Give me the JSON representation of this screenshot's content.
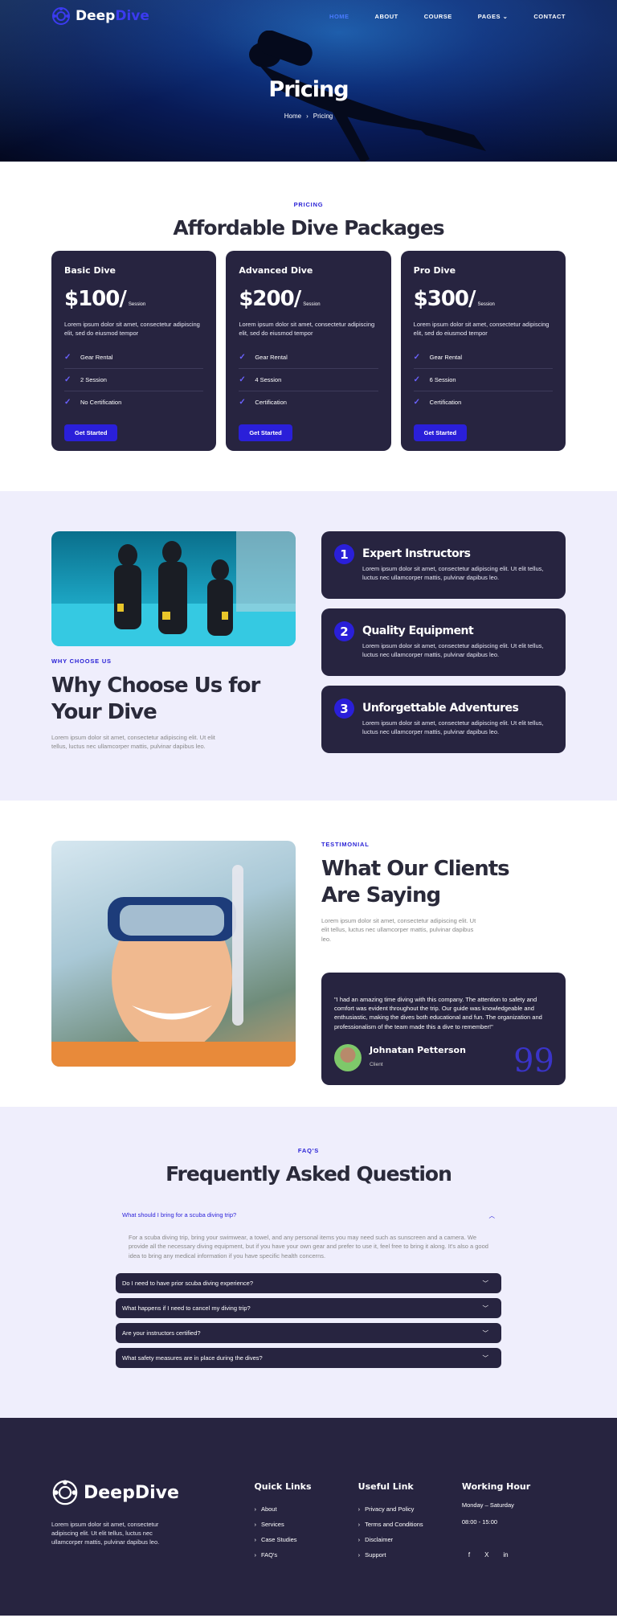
{
  "brand": {
    "name_part1": "Deep",
    "name_part2": "Dive"
  },
  "nav": {
    "items": [
      {
        "label": "HOME",
        "active": true
      },
      {
        "label": "ABOUT"
      },
      {
        "label": "COURSE"
      },
      {
        "label": "PAGES"
      },
      {
        "label": "CONTACT"
      }
    ]
  },
  "hero": {
    "title": "Pricing",
    "crumb_home": "Home",
    "crumb_current": "Pricing"
  },
  "pricing": {
    "eyebrow": "PRICING",
    "title": "Affordable Dive Packages",
    "cards": [
      {
        "name": "Basic Dive",
        "price": "$100/",
        "per": "Session",
        "desc": "Lorem ipsum dolor sit amet, consectetur adipiscing elit, sed do eiusmod tempor",
        "features": [
          "Gear Rental",
          "2 Session",
          "No Certification"
        ],
        "button": "Get Started"
      },
      {
        "name": "Advanced Dive",
        "price": "$200/",
        "per": "Session",
        "desc": "Lorem ipsum dolor sit amet, consectetur adipiscing elit, sed do eiusmod tempor",
        "features": [
          "Gear Rental",
          "4 Session",
          "Certification"
        ],
        "button": "Get Started"
      },
      {
        "name": "Pro Dive",
        "price": "$300/",
        "per": "Session",
        "desc": "Lorem ipsum dolor sit amet, consectetur adipiscing elit, sed do eiusmod tempor",
        "features": [
          "Gear Rental",
          "6 Session",
          "Certification"
        ],
        "button": "Get Started"
      }
    ]
  },
  "why": {
    "eyebrow": "WHY CHOOSE US",
    "title_line1": "Why Choose Us for",
    "title_line2": "Your Dive",
    "desc": "Lorem ipsum dolor sit amet, consectetur adipiscing elit. Ut elit tellus, luctus nec ullamcorper mattis, pulvinar dapibus leo.",
    "features": [
      {
        "num": "1",
        "title": "Expert Instructors",
        "desc": "Lorem ipsum dolor sit amet, consectetur adipiscing elit. Ut elit tellus, luctus nec ullamcorper mattis, pulvinar dapibus leo."
      },
      {
        "num": "2",
        "title": "Quality Equipment",
        "desc": "Lorem ipsum dolor sit amet, consectetur adipiscing elit. Ut elit tellus, luctus nec ullamcorper mattis, pulvinar dapibus leo."
      },
      {
        "num": "3",
        "title": "Unforgettable Adventures",
        "desc": "Lorem ipsum dolor sit amet, consectetur adipiscing elit. Ut elit tellus, luctus nec ullamcorper mattis, pulvinar dapibus leo."
      }
    ]
  },
  "testimonial": {
    "eyebrow": "TESTIMONIAL",
    "title_line1": "What Our Clients",
    "title_line2": "Are Saying",
    "desc": "Lorem ipsum dolor sit amet, consectetur adipiscing elit. Ut elit tellus, luctus nec ullamcorper mattis, pulvinar dapibus leo.",
    "quote": "\"I had an amazing time diving with this company. The attention to safety and comfort was evident throughout the trip. Our guide was knowledgeable and enthusiastic, making the dives both educational and fun. The organization and professionalism of the team made this a dive to remember!\"",
    "author": "Johnatan Petterson",
    "role": "Client"
  },
  "faq": {
    "eyebrow": "FAQ'S",
    "title": "Frequently Asked Question",
    "open_question": "What should I bring for a scuba diving trip?",
    "open_answer": "For a scuba diving trip, bring your swimwear, a towel, and any personal items you may need such as sunscreen and a camera. We provide all the necessary diving equipment, but if you have your own gear and prefer to use it, feel free to bring it along. It's also a good idea to bring any medical information if you have specific health concerns.",
    "questions": [
      "Do I need to have prior scuba diving experience?",
      "What happens if I need to cancel my diving trip?",
      "Are your instructors certified?",
      "What safety measures are in place during the dives?"
    ]
  },
  "footer": {
    "brand": "DeepDive",
    "desc": "Lorem ipsum dolor sit amet, consectetur adipiscing elit. Ut elit tellus, luctus nec ullamcorper mattis, pulvinar dapibus leo.",
    "quick_title": "Quick Links",
    "quick_links": [
      "About",
      "Services",
      "Case Studies",
      "FAQ's"
    ],
    "useful_title": "Useful Link",
    "useful_links": [
      "Privacy and Policy",
      "Terms and Conditions",
      "Disclaimer",
      "Support"
    ],
    "hours_title": "Working Hour",
    "days": "Monday – Saturday",
    "hours": "08:00 - 15:00",
    "social": [
      "f",
      "X",
      "in"
    ]
  },
  "colors": {
    "accent": "#2a1fd9",
    "card": "#272440",
    "light_bg": "#efeefc"
  }
}
